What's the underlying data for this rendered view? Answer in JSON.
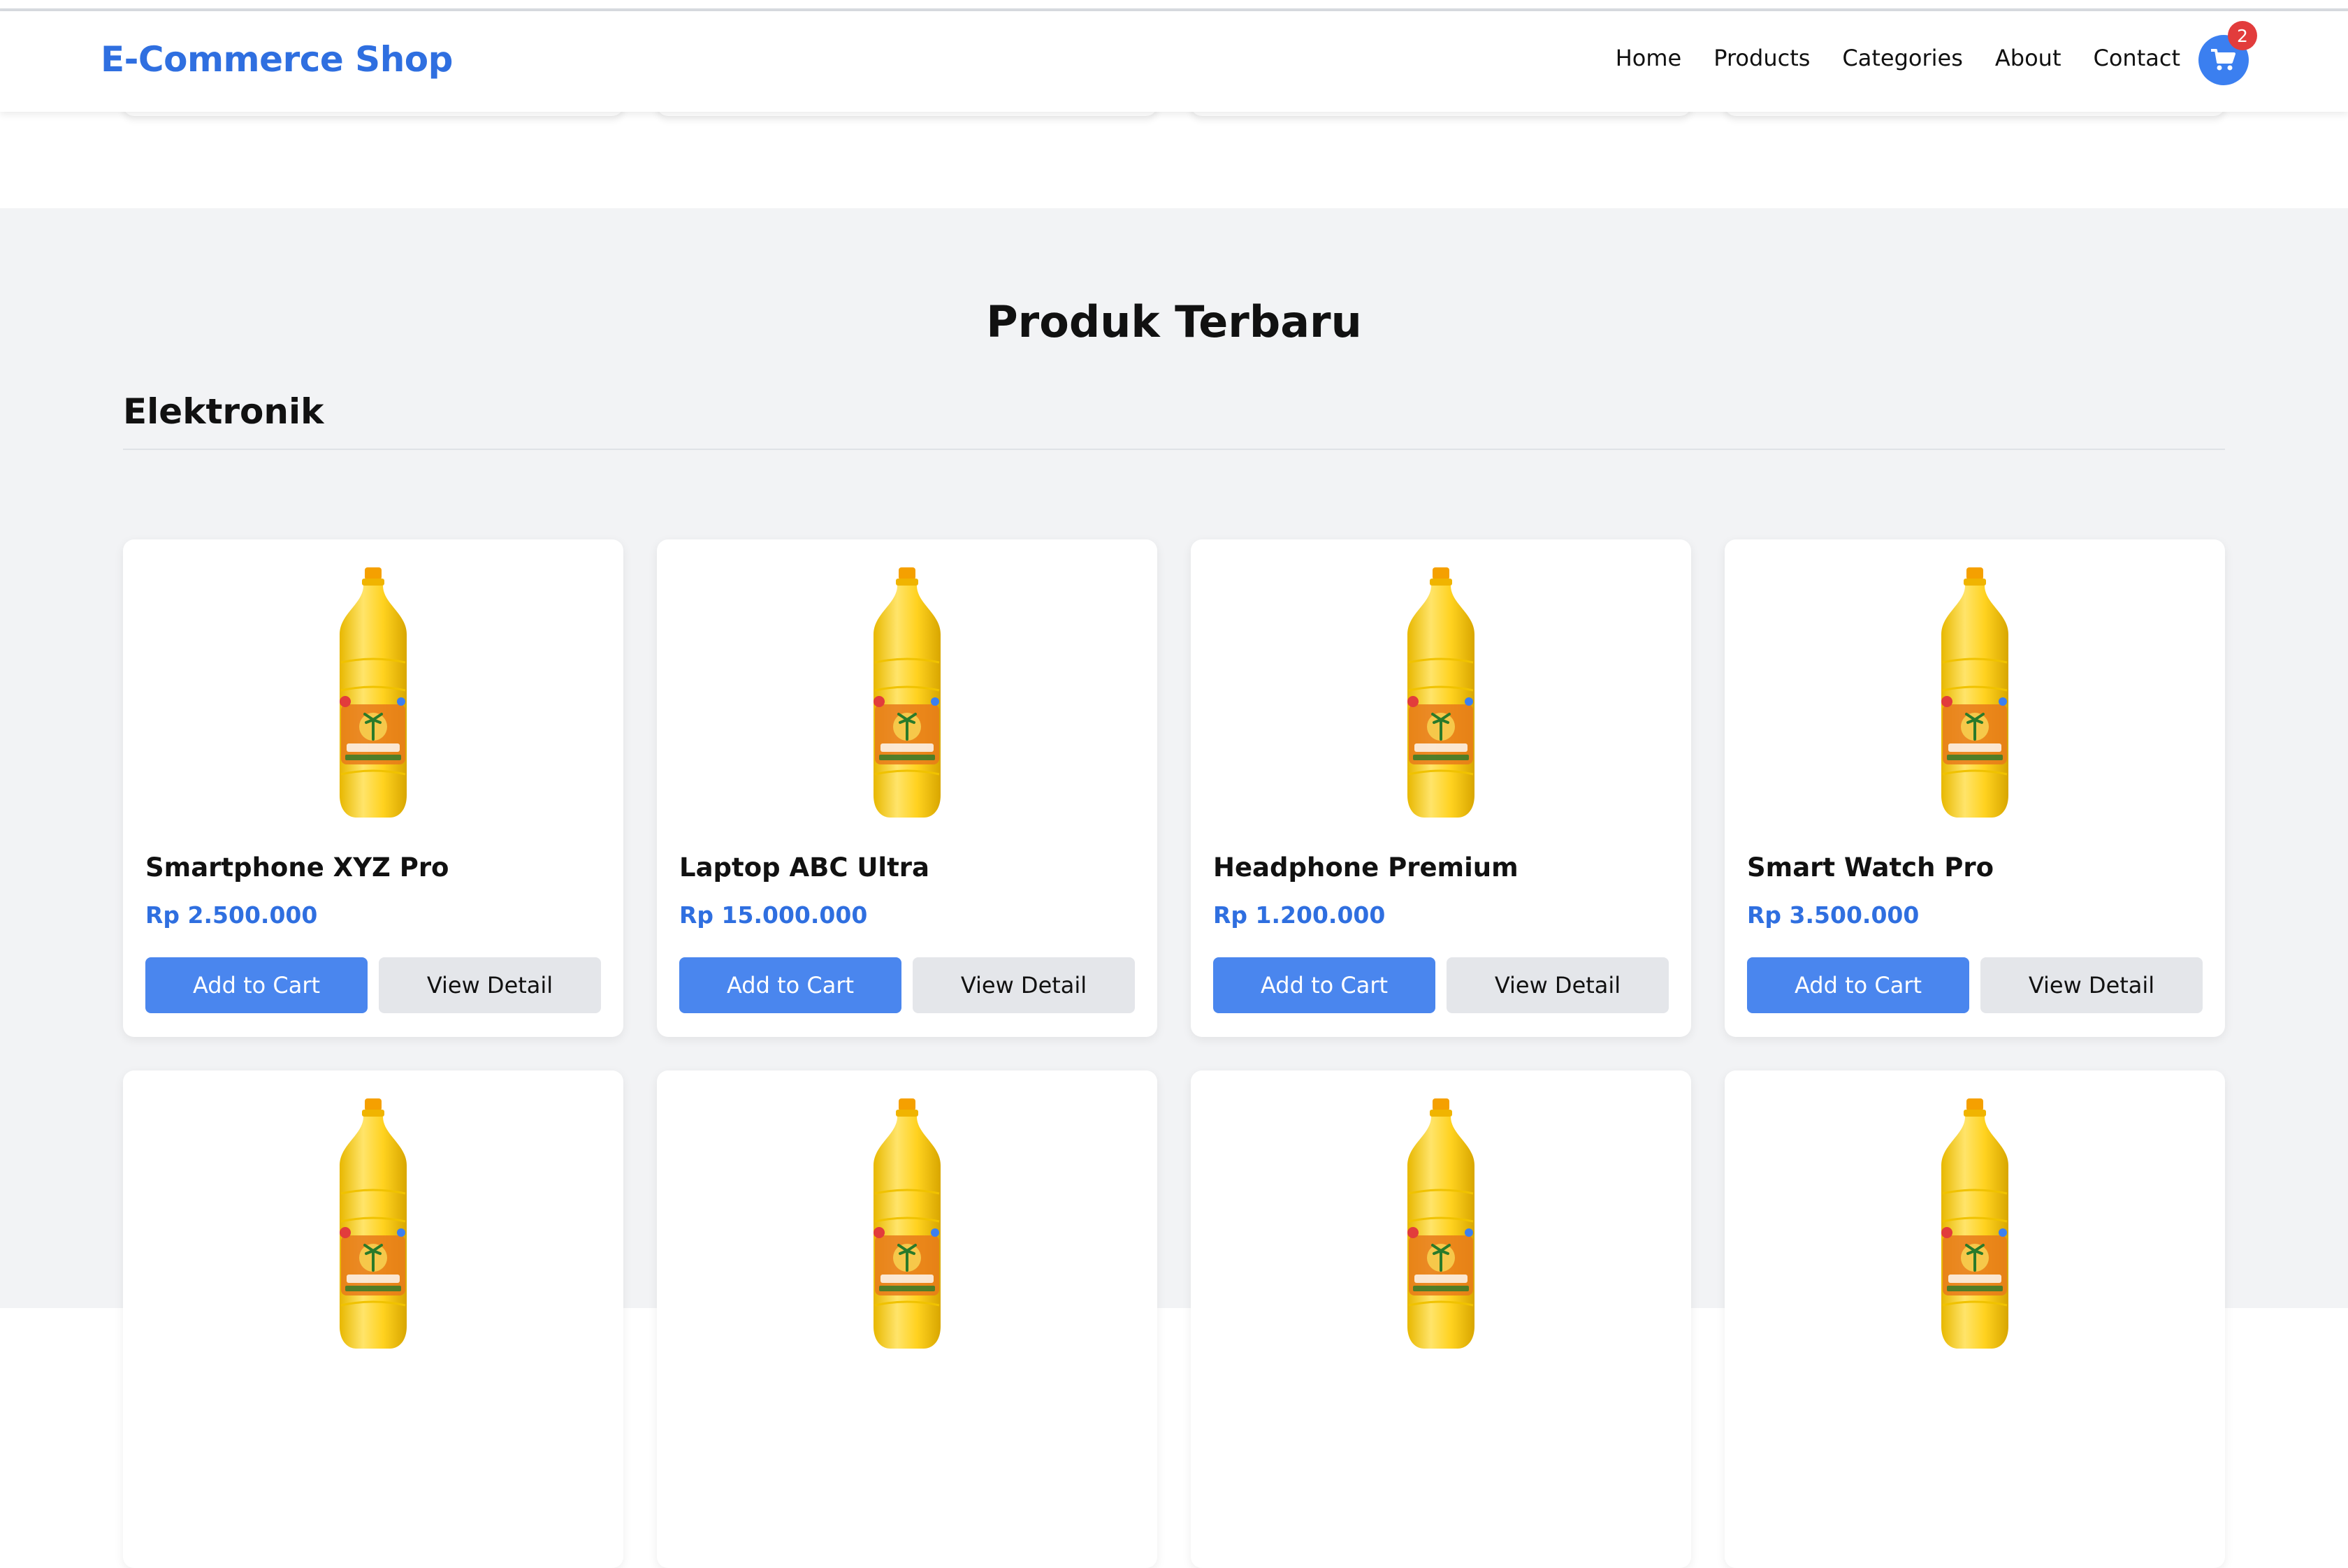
{
  "header": {
    "brand": "E-Commerce Shop",
    "nav": [
      "Home",
      "Products",
      "Categories",
      "About",
      "Contact"
    ],
    "cart_count": "2",
    "cart_icon": "shopping-cart-icon"
  },
  "section": {
    "title": "Produk Terbaru",
    "category": "Elektronik"
  },
  "products": [
    {
      "name": "Smartphone XYZ Pro",
      "price": "Rp 2.500.000",
      "add": "Add to Cart",
      "view": "View Detail"
    },
    {
      "name": "Laptop ABC Ultra",
      "price": "Rp 15.000.000",
      "add": "Add to Cart",
      "view": "View Detail"
    },
    {
      "name": "Headphone Premium",
      "price": "Rp 1.200.000",
      "add": "Add to Cart",
      "view": "View Detail"
    },
    {
      "name": "Smart Watch Pro",
      "price": "Rp 3.500.000",
      "add": "Add to Cart",
      "view": "View Detail"
    }
  ],
  "colors": {
    "accent": "#2f6fe0",
    "button": "#4a86ee",
    "badge": "#e23c3c",
    "section_bg": "#f2f3f5"
  }
}
